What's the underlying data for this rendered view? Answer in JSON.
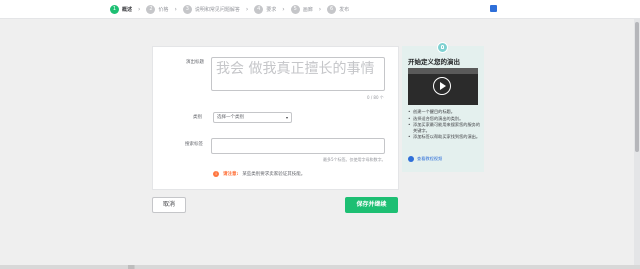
{
  "steps": [
    {
      "num": "1",
      "label": "概述"
    },
    {
      "num": "2",
      "label": "价格"
    },
    {
      "num": "3",
      "label": "说明和常见问题解答"
    },
    {
      "num": "4",
      "label": "要求"
    },
    {
      "num": "5",
      "label": "画廊"
    },
    {
      "num": "6",
      "label": "发布"
    }
  ],
  "form": {
    "title_label": "演出标题",
    "title_placeholder": "我会 做我真正擅长的事情",
    "title_counter": "0 / 80 个",
    "category_label": "类别",
    "category_value": "选择一个类别",
    "tags_label": "搜索标签",
    "tags_hint": "最多5个标签。仅使用字母和数字。",
    "note_label": "请注意:",
    "note_text": "某些类别要求卖家验证其技能。"
  },
  "actions": {
    "cancel": "取消",
    "save": "保存并继续"
  },
  "side_panel": {
    "title": "开始定义您的演出",
    "tips": [
      "创建一个醒目的标题。",
      "选择适合您的演出的类别。",
      "添加买家最可能用来搜索您的服务的关键字。",
      "添加标签以帮助买家找到您的演出。"
    ],
    "help": "查看教程视频"
  },
  "colors": {
    "accent": "#1dbf73",
    "warning": "#ff7640",
    "link": "#2e6fd9",
    "panel_bg": "#e4f0ee"
  }
}
